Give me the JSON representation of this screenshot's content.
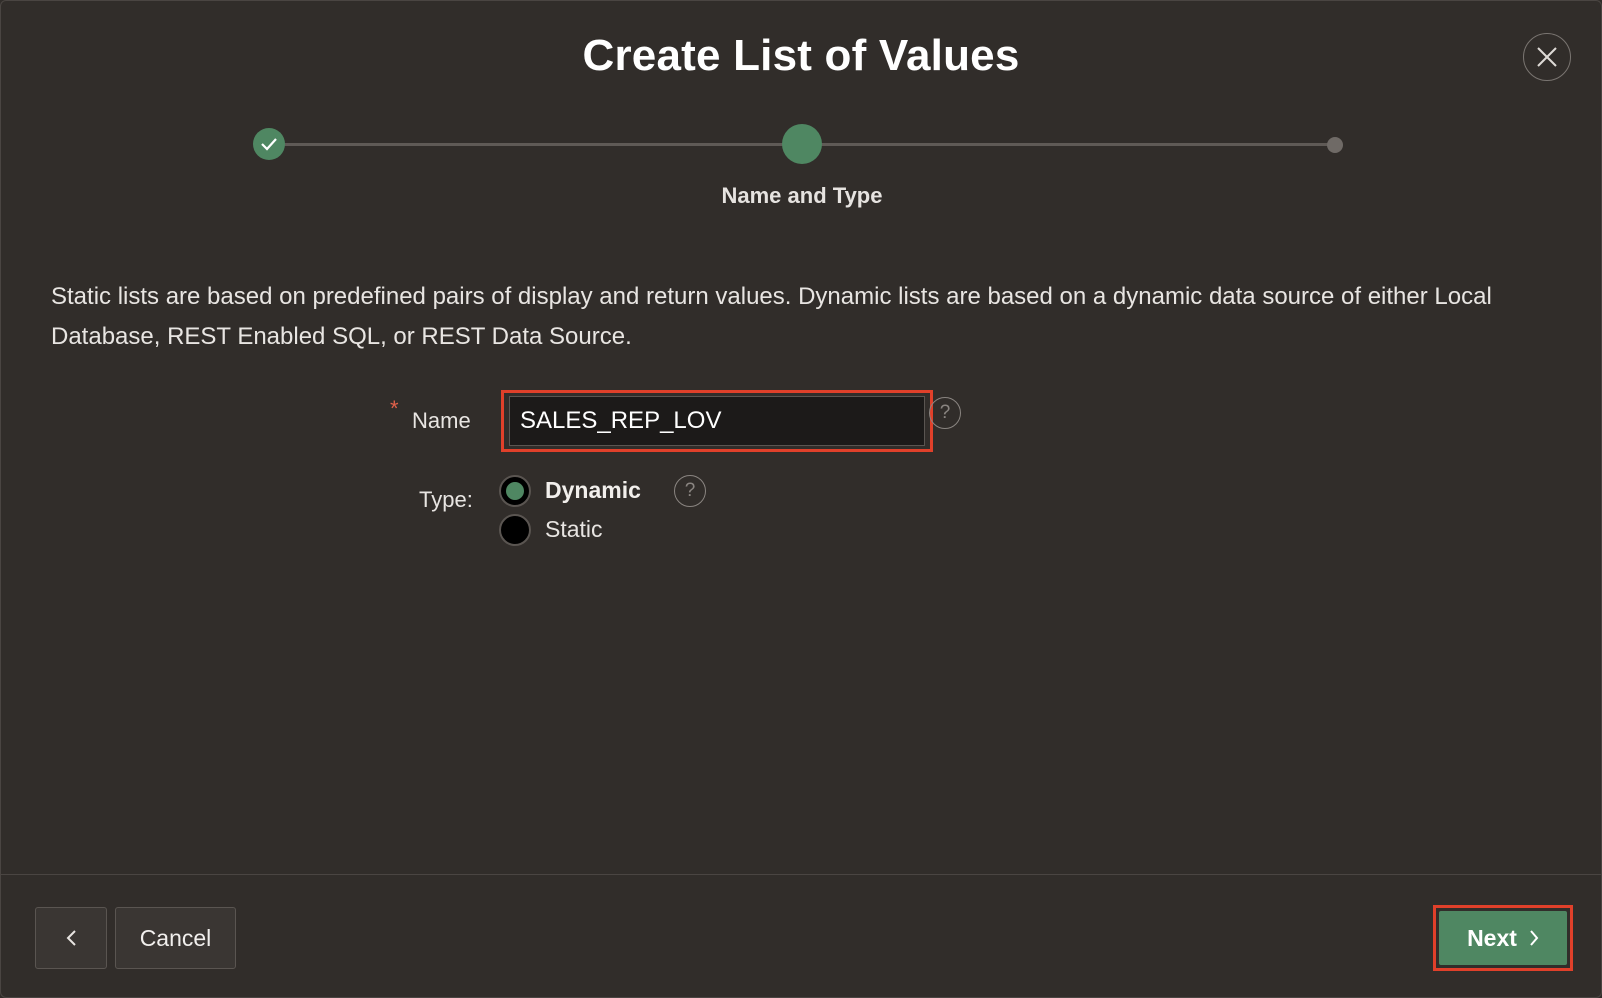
{
  "dialog": {
    "title": "Create List of Values"
  },
  "progress": {
    "current_step_label": "Name and Type",
    "steps": [
      {
        "state": "complete",
        "icon": "check-icon"
      },
      {
        "state": "current"
      },
      {
        "state": "upcoming"
      }
    ]
  },
  "description": "Static lists are based on predefined pairs of display and return values. Dynamic lists are based on a dynamic data source of either Local Database, REST Enabled SQL, or REST Data Source.",
  "form": {
    "name": {
      "label": "Name",
      "required_marker": "*",
      "value": "SALES_REP_LOV",
      "help_glyph": "?"
    },
    "type": {
      "label": "Type:",
      "help_glyph": "?",
      "options": [
        {
          "label": "Dynamic",
          "selected": true
        },
        {
          "label": "Static",
          "selected": false
        }
      ]
    }
  },
  "footer": {
    "back_icon": "chevron-left-icon",
    "cancel_label": "Cancel",
    "next_label": "Next",
    "next_icon": "chevron-right-icon"
  },
  "colors": {
    "background": "#312d2a",
    "accent_green": "#4f8762",
    "highlight_red": "#e0402a",
    "required_star": "#e0604a"
  }
}
